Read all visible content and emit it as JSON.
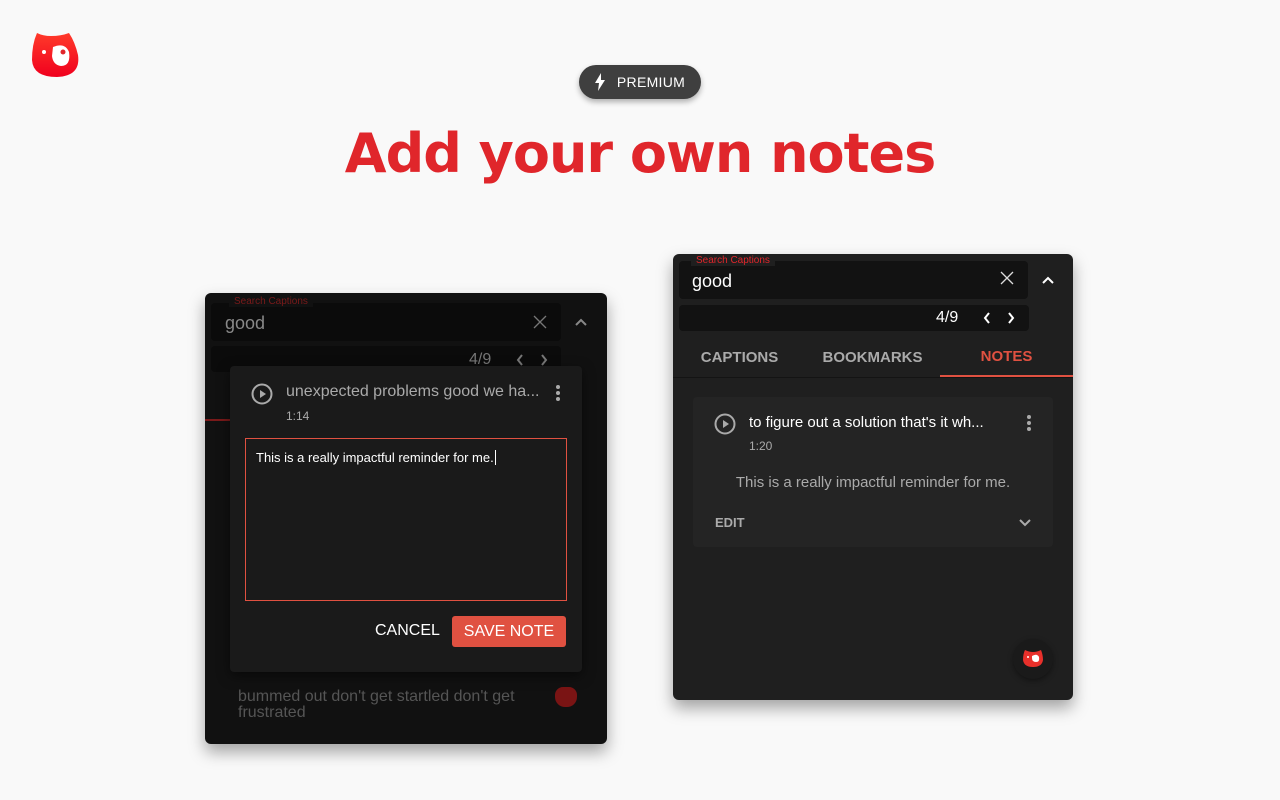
{
  "header": {
    "badge_label": "PREMIUM",
    "title": "Add your own notes"
  },
  "left_panel": {
    "search_label": "Search Captions",
    "search_value": "good",
    "match_count": "4/9",
    "dialog": {
      "caption_text": "unexpected problems good we ha...",
      "timestamp": "1:14",
      "note_value": "This is a really impactful reminder for me.",
      "cancel_label": "CANCEL",
      "save_label": "SAVE NOTE"
    },
    "background_caption": "bummed out don't get startled don't get frustrated"
  },
  "right_panel": {
    "search_label": "Search Captions",
    "search_value": "good",
    "match_count": "4/9",
    "tabs": [
      {
        "label": "CAPTIONS"
      },
      {
        "label": "BOOKMARKS"
      },
      {
        "label": "NOTES",
        "active": true
      }
    ],
    "note": {
      "caption_text": "to figure out a solution that's it wh...",
      "timestamp": "1:20",
      "body": "This is a really impactful reminder for me.",
      "edit_label": "EDIT"
    }
  },
  "colors": {
    "brand": "#e0262b",
    "accent": "#e05141",
    "panel_bg": "#1f1f1f"
  }
}
